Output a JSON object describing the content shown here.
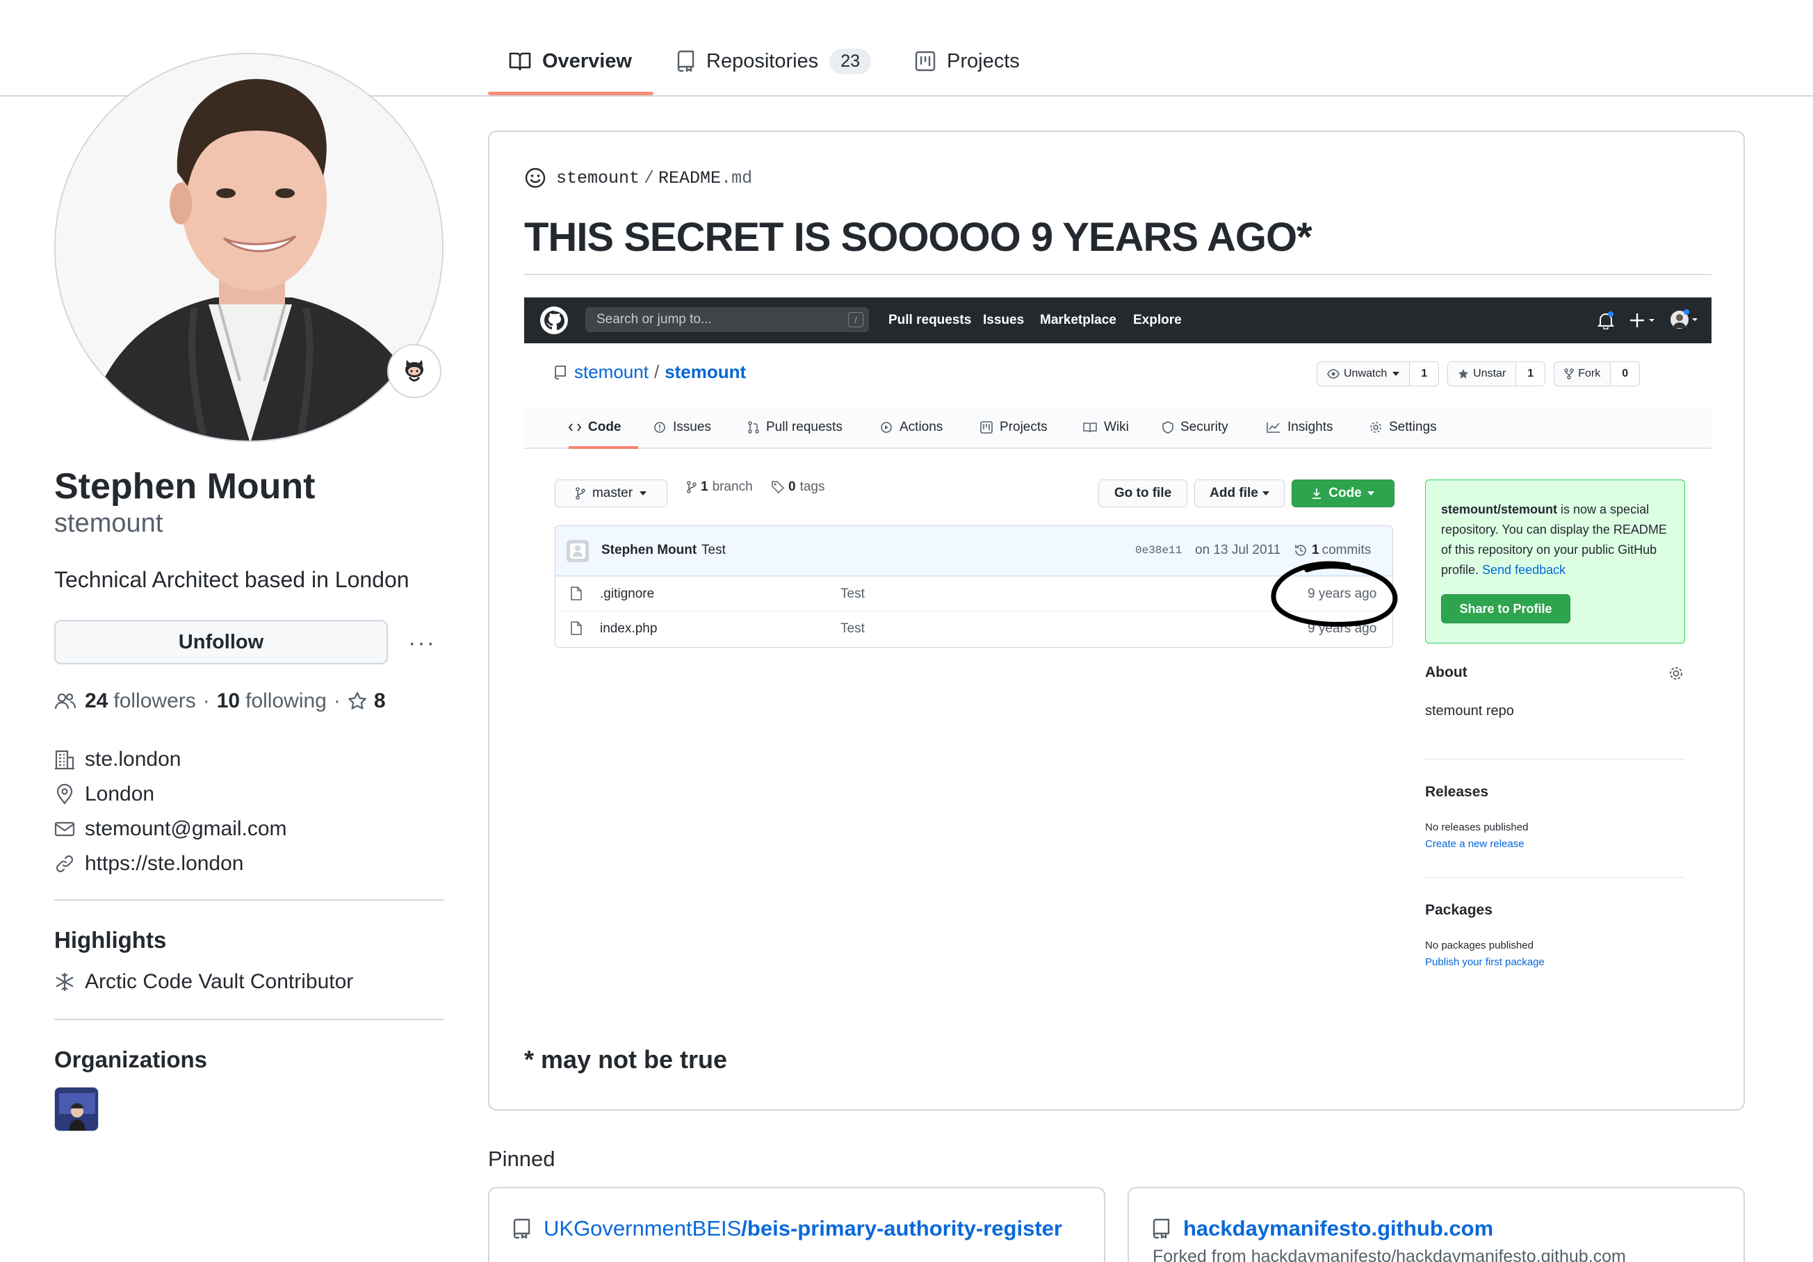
{
  "tabs": [
    {
      "label": "Overview",
      "icon": "book-icon",
      "active": true
    },
    {
      "label": "Repositories",
      "icon": "repo-icon",
      "count": "23"
    },
    {
      "label": "Projects",
      "icon": "project-icon"
    }
  ],
  "profile": {
    "full_name": "Stephen Mount",
    "login": "stemount",
    "bio": "Technical Architect based in London",
    "unfollow_label": "Unfollow",
    "more_label": "···",
    "followers_count": "24",
    "followers_label": "followers",
    "following_count": "10",
    "following_label": "following",
    "separator": "·",
    "stars_count": "8",
    "company": "ste.london",
    "location": "London",
    "email": "stemount@gmail.com",
    "website": "https://ste.london"
  },
  "highlights": {
    "heading": "Highlights",
    "items": [
      "Arctic Code Vault Contributor"
    ]
  },
  "organizations": {
    "heading": "Organizations"
  },
  "readme": {
    "owner": "stemount",
    "slash": "/",
    "file": "README",
    "ext": ".md",
    "title": "THIS SECRET IS SOOOOO 9 YEARS AGO*",
    "footnote": "* may not be true"
  },
  "screenshot": {
    "search_placeholder": "Search or jump to...",
    "search_key": "/",
    "nav": [
      "Pull requests",
      "Issues",
      "Marketplace",
      "Explore"
    ],
    "repo_owner": "stemount",
    "repo_sep": "/",
    "repo_name": "stemount",
    "unwatch_label": "Unwatch",
    "unwatch_count": "1",
    "unstar_label": "Unstar",
    "unstar_count": "1",
    "fork_label": "Fork",
    "fork_count": "0",
    "repo_tabs": [
      "Code",
      "Issues",
      "Pull requests",
      "Actions",
      "Projects",
      "Wiki",
      "Security",
      "Insights",
      "Settings"
    ],
    "branch_label": "master",
    "branch_count": "1",
    "branch_word": "branch",
    "tags_count": "0",
    "tags_word": "tags",
    "goto_file": "Go to file",
    "add_file": "Add file",
    "code_btn": "Code",
    "commit_author": "Stephen Mount",
    "commit_message": "Test",
    "commit_sha": "0e38e11",
    "commit_date": "on 13 Jul 2011",
    "commits_count": "1",
    "commits_word": "commits",
    "files": [
      {
        "name": ".gitignore",
        "message": "Test",
        "age": "9 years ago"
      },
      {
        "name": "index.php",
        "message": "Test",
        "age": "9 years ago"
      }
    ],
    "special_repo_bold": "stemount/stemount",
    "special_repo_text": " is now a special repository. You can display the README of this repository on your public GitHub profile. ",
    "special_repo_link": "Send feedback",
    "share_label": "Share to Profile",
    "about_heading": "About",
    "about_text": "stemount repo",
    "releases_heading": "Releases",
    "releases_text": "No releases published",
    "releases_link": "Create a new release",
    "packages_heading": "Packages",
    "packages_text": "No packages published",
    "packages_link": "Publish your first package"
  },
  "pinned": {
    "heading": "Pinned",
    "repos": [
      {
        "owner": "UKGovernmentBEIS",
        "name": "/beis-primary-authority-register",
        "forked_from": ""
      },
      {
        "owner": "",
        "name": "hackdaymanifesto.github.com",
        "forked_from": "Forked from hackdaymanifesto/hackdaymanifesto.github.com"
      }
    ]
  },
  "colors": {
    "link": "#0969da",
    "tab_underline": "#fd8c73",
    "green_button": "#2ea44f",
    "special_repo_bg": "#dcffe4"
  }
}
